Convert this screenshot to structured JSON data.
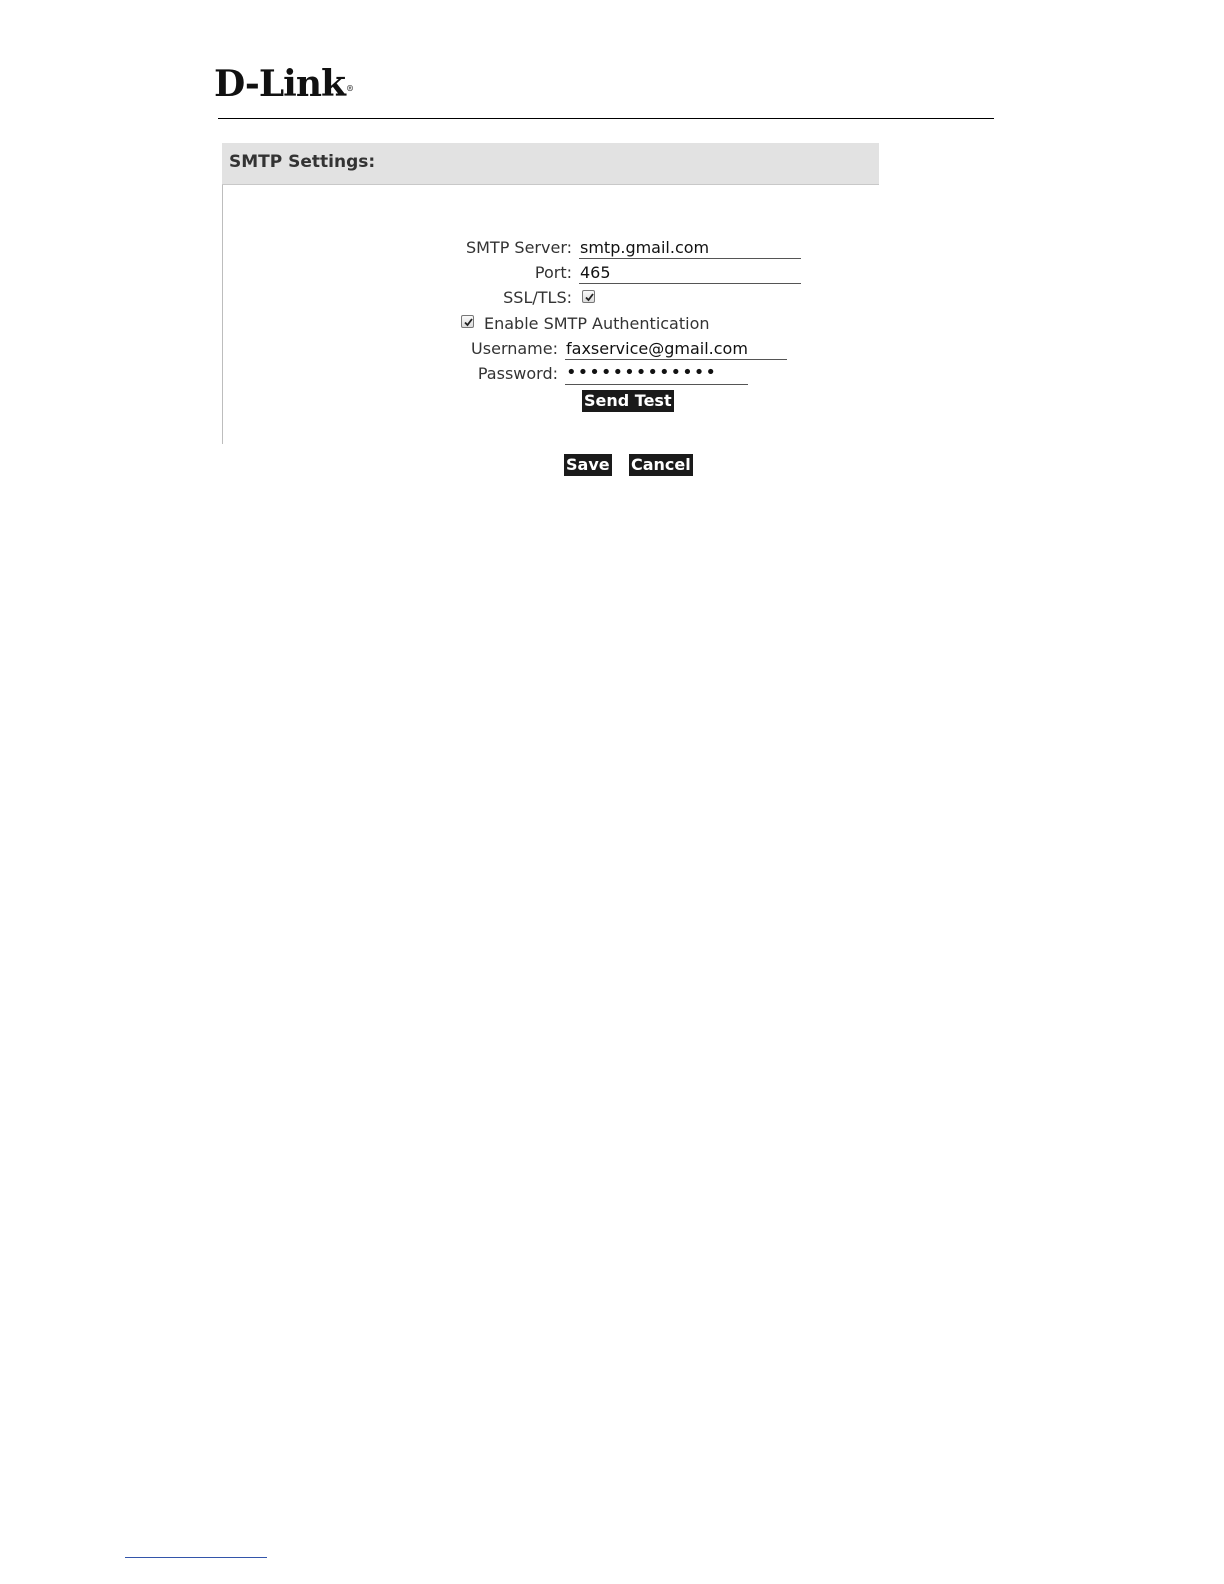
{
  "header": {
    "logo_text": "D-Link",
    "logo_mark": "®"
  },
  "panel": {
    "title": "SMTP Settings:",
    "smtp_server": {
      "label": "SMTP Server:",
      "value": "smtp.gmail.com"
    },
    "port": {
      "label": "Port:",
      "value": "465"
    },
    "ssl_tls": {
      "label": "SSL/TLS:",
      "checked": true
    },
    "auth": {
      "label": "Enable SMTP Authentication",
      "checked": true
    },
    "username": {
      "label": "Username:",
      "value": "faxservice@gmail.com"
    },
    "password": {
      "label": "Password:",
      "masked_value": "•••••••••••••"
    },
    "send_test_label": "Send Test",
    "save_label": "Save",
    "cancel_label": "Cancel"
  }
}
